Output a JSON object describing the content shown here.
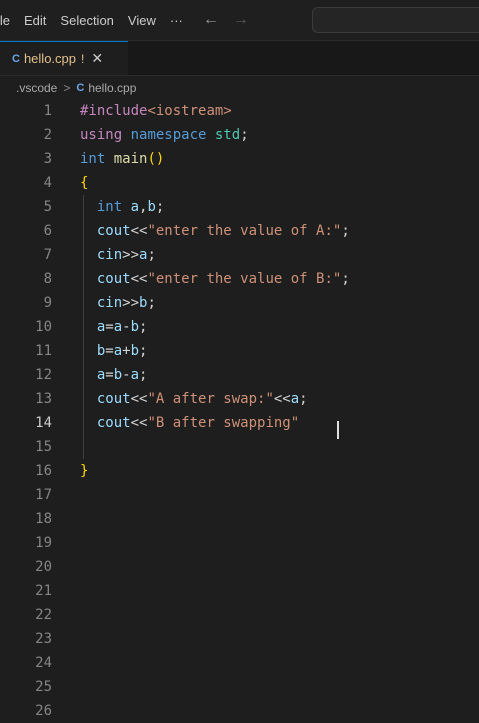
{
  "menu": {
    "items": [
      "ile",
      "Edit",
      "Selection",
      "View",
      "···"
    ],
    "back_icon": "←",
    "forward_icon": "→"
  },
  "tab": {
    "icon": "C",
    "label": "hello.cpp",
    "modified": "!",
    "close": "✕"
  },
  "breadcrumb": {
    "folder": ".vscode",
    "separator": ">",
    "file_icon": "C",
    "file": "hello.cpp"
  },
  "editor": {
    "active_line": 14,
    "lines": [
      {
        "n": "1",
        "tokens": [
          {
            "t": "#include",
            "c": "pp"
          },
          {
            "t": "<iostream>",
            "c": "s"
          }
        ]
      },
      {
        "n": "2",
        "tokens": [
          {
            "t": "using",
            "c": "pp"
          },
          {
            "t": " ",
            "c": "plain"
          },
          {
            "t": "namespace",
            "c": "k"
          },
          {
            "t": " ",
            "c": "plain"
          },
          {
            "t": "std",
            "c": "ty"
          },
          {
            "t": ";",
            "c": "plain"
          }
        ]
      },
      {
        "n": "3",
        "tokens": [
          {
            "t": "int",
            "c": "k"
          },
          {
            "t": " ",
            "c": "plain"
          },
          {
            "t": "main",
            "c": "fn"
          },
          {
            "t": "()",
            "c": "br"
          }
        ]
      },
      {
        "n": "4",
        "tokens": [
          {
            "t": "{",
            "c": "br"
          }
        ]
      },
      {
        "n": "5",
        "tokens": [
          {
            "t": "  ",
            "c": "plain"
          },
          {
            "t": "int",
            "c": "k"
          },
          {
            "t": " ",
            "c": "plain"
          },
          {
            "t": "a",
            "c": "v"
          },
          {
            "t": ",",
            "c": "plain"
          },
          {
            "t": "b",
            "c": "v"
          },
          {
            "t": ";",
            "c": "plain"
          }
        ]
      },
      {
        "n": "6",
        "tokens": [
          {
            "t": "  ",
            "c": "plain"
          },
          {
            "t": "cout",
            "c": "v"
          },
          {
            "t": "<<",
            "c": "plain"
          },
          {
            "t": "\"enter the value of A:\"",
            "c": "s"
          },
          {
            "t": ";",
            "c": "plain"
          }
        ]
      },
      {
        "n": "7",
        "tokens": [
          {
            "t": "  ",
            "c": "plain"
          },
          {
            "t": "cin",
            "c": "v"
          },
          {
            "t": ">>",
            "c": "plain"
          },
          {
            "t": "a",
            "c": "v"
          },
          {
            "t": ";",
            "c": "plain"
          }
        ]
      },
      {
        "n": "8",
        "tokens": [
          {
            "t": "  ",
            "c": "plain"
          },
          {
            "t": "cout",
            "c": "v"
          },
          {
            "t": "<<",
            "c": "plain"
          },
          {
            "t": "\"enter the value of B:\"",
            "c": "s"
          },
          {
            "t": ";",
            "c": "plain"
          }
        ]
      },
      {
        "n": "9",
        "tokens": [
          {
            "t": "  ",
            "c": "plain"
          },
          {
            "t": "cin",
            "c": "v"
          },
          {
            "t": ">>",
            "c": "plain"
          },
          {
            "t": "b",
            "c": "v"
          },
          {
            "t": ";",
            "c": "plain"
          }
        ]
      },
      {
        "n": "10",
        "tokens": [
          {
            "t": "  ",
            "c": "plain"
          },
          {
            "t": "a",
            "c": "v"
          },
          {
            "t": "=",
            "c": "plain"
          },
          {
            "t": "a",
            "c": "v"
          },
          {
            "t": "-",
            "c": "plain"
          },
          {
            "t": "b",
            "c": "v"
          },
          {
            "t": ";",
            "c": "plain"
          }
        ]
      },
      {
        "n": "11",
        "tokens": [
          {
            "t": "  ",
            "c": "plain"
          },
          {
            "t": "b",
            "c": "v"
          },
          {
            "t": "=",
            "c": "plain"
          },
          {
            "t": "a",
            "c": "v"
          },
          {
            "t": "+",
            "c": "plain"
          },
          {
            "t": "b",
            "c": "v"
          },
          {
            "t": ";",
            "c": "plain"
          }
        ]
      },
      {
        "n": "12",
        "tokens": [
          {
            "t": "  ",
            "c": "plain"
          },
          {
            "t": "a",
            "c": "v"
          },
          {
            "t": "=",
            "c": "plain"
          },
          {
            "t": "b",
            "c": "v"
          },
          {
            "t": "-",
            "c": "plain"
          },
          {
            "t": "a",
            "c": "v"
          },
          {
            "t": ";",
            "c": "plain"
          }
        ]
      },
      {
        "n": "13",
        "tokens": [
          {
            "t": "  ",
            "c": "plain"
          },
          {
            "t": "cout",
            "c": "v"
          },
          {
            "t": "<<",
            "c": "plain"
          },
          {
            "t": "\"A after swap:\"",
            "c": "s"
          },
          {
            "t": "<<",
            "c": "plain"
          },
          {
            "t": "a",
            "c": "v"
          },
          {
            "t": ";",
            "c": "plain"
          }
        ]
      },
      {
        "n": "14",
        "tokens": [
          {
            "t": "  ",
            "c": "plain"
          },
          {
            "t": "cout",
            "c": "v"
          },
          {
            "t": "<<",
            "c": "plain"
          },
          {
            "t": "\"B after swapping\"",
            "c": "s"
          }
        ]
      },
      {
        "n": "15",
        "tokens": []
      },
      {
        "n": "16",
        "tokens": [
          {
            "t": "}",
            "c": "br"
          }
        ]
      },
      {
        "n": "17",
        "tokens": []
      },
      {
        "n": "18",
        "tokens": []
      },
      {
        "n": "19",
        "tokens": []
      },
      {
        "n": "20",
        "tokens": []
      },
      {
        "n": "21",
        "tokens": []
      },
      {
        "n": "22",
        "tokens": []
      },
      {
        "n": "23",
        "tokens": []
      },
      {
        "n": "24",
        "tokens": []
      },
      {
        "n": "25",
        "tokens": []
      },
      {
        "n": "26",
        "tokens": []
      }
    ]
  }
}
